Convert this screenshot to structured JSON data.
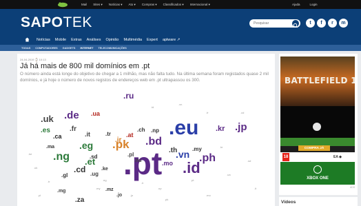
{
  "topbar": {
    "links": [
      "Mail",
      "Sites ▾",
      "Notícias ▾",
      "Ato ▾",
      "Compras ▾",
      "Classificados ▾",
      "Internacional ▾"
    ],
    "right": [
      "Ajuda",
      "Login"
    ]
  },
  "header": {
    "brand_bold": "SAPO",
    "brand_light": "TEK",
    "search_placeholder": "Pesquisar",
    "socials": [
      "t",
      "f",
      "r",
      "m"
    ]
  },
  "nav": {
    "items": [
      "Notícias",
      "Mobile",
      "Extras",
      "Análises",
      "Opinião",
      "Multimédia",
      "Expert",
      "aplware ↗"
    ]
  },
  "subnav": {
    "items": [
      "TODAS",
      "COMPUTADORES",
      "GADGETS",
      "INTERNET",
      "TELECOMUNICAÇÕES"
    ]
  },
  "article": {
    "meta": "24-04-2019 ⌚ 10:13",
    "title": "Já há mais de 800 mil domínios em .pt",
    "lead": "O número ainda está longe do objetivo de chegar a 1 milhão, mas não falta tudo. Na última semana foram registados quase 2 mil domínios, e já hoje o número de novos registos de endereços web em .pt ultrapassou os 300."
  },
  "cloud_words": [
    ".pt",
    ".eu",
    ".id",
    ".bd",
    ".pk",
    ".ng",
    ".jp",
    ".kr",
    ".ph",
    ".vn",
    ".th",
    ".mo",
    ".uk",
    ".de",
    ".ua",
    ".es",
    ".fr",
    ".ca",
    ".it",
    ".eg",
    ".et",
    ".sd",
    ".ma",
    ".cd",
    ".ug",
    ".ke",
    ".ir",
    ".at",
    ".tr",
    ".ch",
    ".pl",
    ".ru",
    ".gl",
    ".np",
    ".hu",
    ".my",
    ".za",
    ".jo",
    ".mz",
    ".mg"
  ],
  "sidebar": {
    "ad_title": "BATTLEFIELD 1",
    "ad_cta": "COMPRA JÁ",
    "ad_rating": "18",
    "ad_platform": "XBOX ONE",
    "ad_note": "ADS",
    "videos_label": "Vídeos"
  },
  "colors": {
    "brand_blue": "#0c3f77",
    "subnav_blue": "#2d5f99",
    "pt_purple": "#5b2a86",
    "eu_blue": "#2b3fa8",
    "pk_orange": "#d8822a"
  }
}
